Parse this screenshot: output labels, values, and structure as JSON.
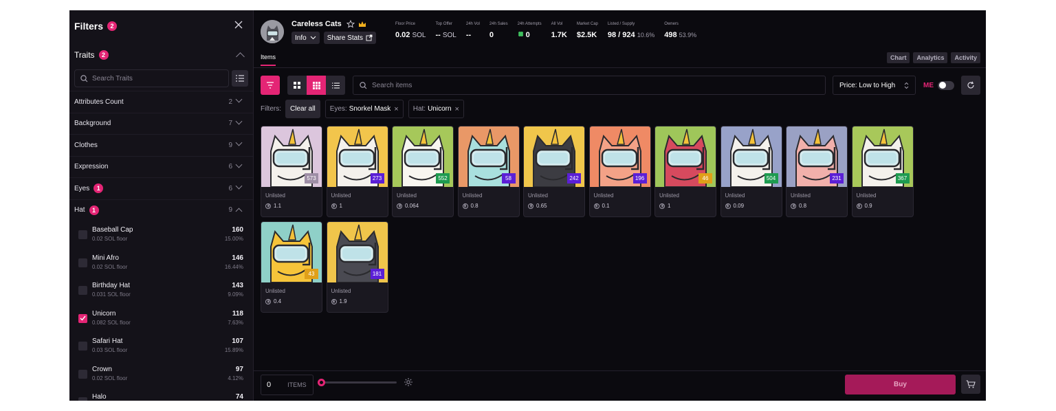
{
  "sidebar": {
    "title": "Filters",
    "filter_count": "2",
    "traits_label": "Traits",
    "traits_count": "2",
    "search_placeholder": "Search Traits",
    "categories": [
      {
        "name": "Attributes Count",
        "count": "2",
        "badge": ""
      },
      {
        "name": "Background",
        "count": "7",
        "badge": ""
      },
      {
        "name": "Clothes",
        "count": "9",
        "badge": ""
      },
      {
        "name": "Expression",
        "count": "6",
        "badge": ""
      },
      {
        "name": "Eyes",
        "count": "6",
        "badge": "1"
      },
      {
        "name": "Hat",
        "count": "9",
        "badge": "1"
      }
    ],
    "hat_options": [
      {
        "name": "Baseball Cap",
        "floor": "0.02 SOL floor",
        "count": "160",
        "pct": "15.00%",
        "checked": false
      },
      {
        "name": "Mini Afro",
        "floor": "0.02 SOL floor",
        "count": "146",
        "pct": "16.44%",
        "checked": false
      },
      {
        "name": "Birthday Hat",
        "floor": "0.031 SOL floor",
        "count": "143",
        "pct": "9.09%",
        "checked": false
      },
      {
        "name": "Unicorn",
        "floor": "0.082 SOL floor",
        "count": "118",
        "pct": "7.63%",
        "checked": true
      },
      {
        "name": "Safari Hat",
        "floor": "0.03 SOL floor",
        "count": "107",
        "pct": "15.89%",
        "checked": false
      },
      {
        "name": "Crown",
        "floor": "0.02 SOL floor",
        "count": "97",
        "pct": "4.12%",
        "checked": false
      },
      {
        "name": "Halo",
        "floor": "",
        "count": "74",
        "pct": "",
        "checked": false
      }
    ]
  },
  "header": {
    "collection_name": "Careless Cats",
    "info_label": "Info",
    "share_label": "Share Stats",
    "stats": [
      {
        "label": "Floor Price",
        "value": "0.02",
        "unit": "SOL",
        "pct": ""
      },
      {
        "label": "Top Offer",
        "value": "--",
        "unit": "SOL",
        "pct": ""
      },
      {
        "label": "24h Vol",
        "value": "--",
        "unit": "",
        "pct": ""
      },
      {
        "label": "24h Sales",
        "value": "0",
        "unit": "",
        "pct": ""
      },
      {
        "label": "24h Attempts",
        "value": "0",
        "unit": "",
        "pct": ""
      },
      {
        "label": "All Vol",
        "value": "1.7K",
        "unit": "",
        "pct": ""
      },
      {
        "label": "Market Cap",
        "value": "$2.5K",
        "unit": "",
        "pct": ""
      },
      {
        "label": "Listed / Supply",
        "value": "98 / 924",
        "unit": "",
        "pct": "10.6%"
      },
      {
        "label": "Owners",
        "value": "498",
        "unit": "",
        "pct": "53.9%"
      }
    ]
  },
  "tabs": {
    "items_label": "Items",
    "chart_label": "Chart",
    "analytics_label": "Analytics",
    "activity_label": "Activity"
  },
  "toolbar": {
    "search_placeholder": "Search items",
    "sort_value": "Price: Low to High",
    "me_logo": "ME"
  },
  "filters": {
    "label": "Filters:",
    "clear_label": "Clear all",
    "chips": [
      {
        "key": "Eyes:",
        "value": "Snorkel Mask"
      },
      {
        "key": "Hat:",
        "value": "Unicorn"
      }
    ]
  },
  "colors": {
    "accent": "#e42575",
    "panel": "#141219",
    "background": "#0b0a0f"
  },
  "items": [
    {
      "rank": "573",
      "status": "Unlisted",
      "price": "1.1",
      "bg": "#dcc6dd",
      "cat": "#f4f1ec",
      "rank_color": "#9e8ea6"
    },
    {
      "rank": "273",
      "status": "Unlisted",
      "price": "1",
      "bg": "#f2c54c",
      "cat": "#f4f1ec",
      "rank_color": "#5b1fd6"
    },
    {
      "rank": "552",
      "status": "Unlisted",
      "price": "0.064",
      "bg": "#a6c85a",
      "cat": "#f8f6f0",
      "rank_color": "#1e9b50"
    },
    {
      "rank": "58",
      "status": "Unlisted",
      "price": "0.8",
      "bg": "#e99867",
      "cat": "#a9e0de",
      "rank_color": "#5b1fd6"
    },
    {
      "rank": "242",
      "status": "Unlisted",
      "price": "0.65",
      "bg": "#f0c64b",
      "cat": "#3c3c42",
      "rank_color": "#5b1fd6"
    },
    {
      "rank": "196",
      "status": "Unlisted",
      "price": "0.1",
      "bg": "#ef8a65",
      "cat": "#f3a287",
      "rank_color": "#5b1fd6"
    },
    {
      "rank": "46",
      "status": "Unlisted",
      "price": "1",
      "bg": "#9fc65a",
      "cat": "#d64a5e",
      "rank_color": "#e0a019"
    },
    {
      "rank": "504",
      "status": "Unlisted",
      "price": "0.09",
      "bg": "#98a2c9",
      "cat": "#f4f1ec",
      "rank_color": "#1e9b50"
    },
    {
      "rank": "231",
      "status": "Unlisted",
      "price": "0.8",
      "bg": "#9aa1c4",
      "cat": "#f1b0ab",
      "rank_color": "#5b1fd6"
    },
    {
      "rank": "367",
      "status": "Unlisted",
      "price": "0.9",
      "bg": "#a8c85a",
      "cat": "#f4f1ec",
      "rank_color": "#1e9b50"
    },
    {
      "rank": "43",
      "status": "Unlisted",
      "price": "0.4",
      "bg": "#8fd0c8",
      "cat": "#f6c43a",
      "rank_color": "#e0a019"
    },
    {
      "rank": "181",
      "status": "Unlisted",
      "price": "1.9",
      "bg": "#f0c54b",
      "cat": "#4a4a52",
      "rank_color": "#5b1fd6"
    }
  ],
  "bottom": {
    "qty": "0",
    "items_label": "ITEMS",
    "buy_label": "Buy"
  }
}
